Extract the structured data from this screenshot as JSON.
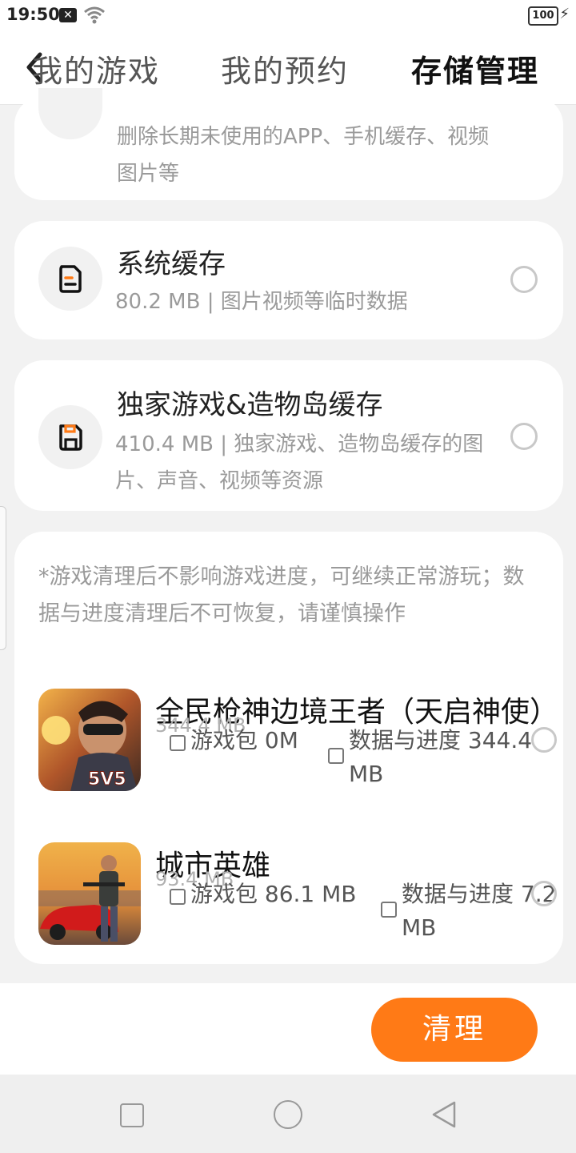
{
  "status_bar": {
    "time": "19:50",
    "notification_icon": "x-box-icon",
    "wifi_icon": "wifi-icon",
    "battery": "100"
  },
  "nav": {
    "back_icon": "chevron-left-icon",
    "tabs": [
      {
        "label": "我的游戏"
      },
      {
        "label": "我的预约"
      },
      {
        "label": "存储管理",
        "active": true
      }
    ],
    "accent_color": "#ff7a16"
  },
  "cards": {
    "top": {
      "desc": "删除长期未使用的APP、手机缓存、视频图片等"
    },
    "system_cache": {
      "icon": "document-icon",
      "title": "系统缓存",
      "desc": "80.2 MB | 图片视频等临时数据"
    },
    "exclusive_cache": {
      "icon": "save-disk-icon",
      "title": "独家游戏&造物岛缓存",
      "desc": "410.4 MB | 独家游戏、造物岛缓存的图片、声音、视频等资源"
    }
  },
  "games_section": {
    "notice": "*游戏清理后不影响游戏进度，可继续正常游玩；数据与进度清理后不可恢复，请谨慎操作",
    "games": [
      {
        "name": "全民枪神边境王者（天启神使）",
        "size": "344.4 MB",
        "package_label": "游戏包 0M",
        "data_label": "数据与进度 344.4 MB"
      },
      {
        "name": "城市英雄",
        "size": "93.4 MB",
        "package_label": "游戏包 86.1 MB",
        "data_label": "数据与进度 7.2 MB"
      }
    ]
  },
  "bottom": {
    "clean_label": "清理"
  }
}
